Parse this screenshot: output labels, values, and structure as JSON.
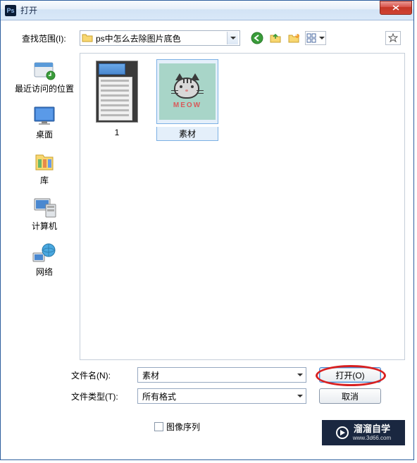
{
  "window": {
    "title": "打开",
    "icon": "Ps"
  },
  "lookup": {
    "label": "查找范围(I):",
    "folder_name": "ps中怎么去除图片底色"
  },
  "toolbar": {
    "back_icon": "back-icon",
    "up_icon": "up-icon",
    "new_folder_icon": "new-folder-icon",
    "view_icon": "view-menu-icon",
    "star_icon": "star-icon"
  },
  "sidebar": [
    {
      "id": "recent",
      "label": "最近访问的位置"
    },
    {
      "id": "desktop",
      "label": "桌面"
    },
    {
      "id": "libraries",
      "label": "库"
    },
    {
      "id": "computer",
      "label": "计算机"
    },
    {
      "id": "network",
      "label": "网络"
    }
  ],
  "files": [
    {
      "name": "1",
      "selected": false,
      "thumb": "psd-doc"
    },
    {
      "name": "素材",
      "selected": true,
      "thumb": "cat",
      "meow": "MEOW"
    }
  ],
  "filename": {
    "label": "文件名(N):",
    "value": "素材"
  },
  "filetype": {
    "label": "文件类型(T):",
    "value": "所有格式"
  },
  "buttons": {
    "open": "打开(O)",
    "cancel": "取消"
  },
  "checkbox": {
    "label": "图像序列",
    "checked": false
  },
  "watermark": {
    "main": "溜溜自学",
    "sub": "www.3d66.com"
  }
}
